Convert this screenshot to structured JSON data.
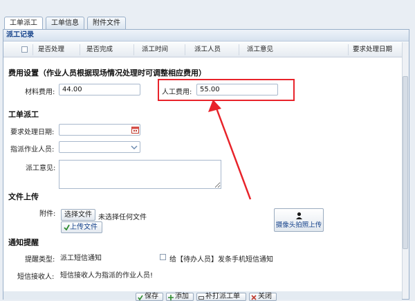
{
  "tabs": [
    {
      "label": "工单派工",
      "active": true
    },
    {
      "label": "工单信息",
      "active": false
    },
    {
      "label": "附件文件",
      "active": false
    }
  ],
  "records": {
    "title": "派工记录",
    "columns": [
      "是否处理",
      "是否完成",
      "派工时间",
      "派工人员",
      "派工意见",
      "要求处理日期"
    ]
  },
  "fee": {
    "title": "费用设置（作业人员根据现场情况处理时可调整相应费用）",
    "material_label": "材料费用:",
    "material_value": "44.00",
    "labor_label": "人工费用:",
    "labor_value": "55.00"
  },
  "dispatch": {
    "title": "工单派工",
    "date_label": "要求处理日期:",
    "date_value": "",
    "worker_label": "指派作业人员:",
    "worker_value": "",
    "opinion_label": "派工意见:"
  },
  "upload": {
    "title": "文件上传",
    "attach_label": "附件:",
    "choose_file": "选择文件",
    "no_file": "未选择任何文件",
    "upload_btn": "上传文件",
    "camera_btn": "摄像头拍照上传"
  },
  "notify": {
    "title": "通知提醒",
    "type_label": "提醒类型:",
    "type_value": "派工短信通知",
    "sms_check_label": "给【待办人员】发条手机短信通知",
    "receiver_label": "短信接收人:",
    "receiver_value": "短信接收人为指派的作业人员!"
  },
  "footer": {
    "save": "保存",
    "add": "添加",
    "supplement": "补打派工单",
    "close": "关闭"
  },
  "colors": {
    "highlight": "#e8232a",
    "accent": "#15428b"
  }
}
